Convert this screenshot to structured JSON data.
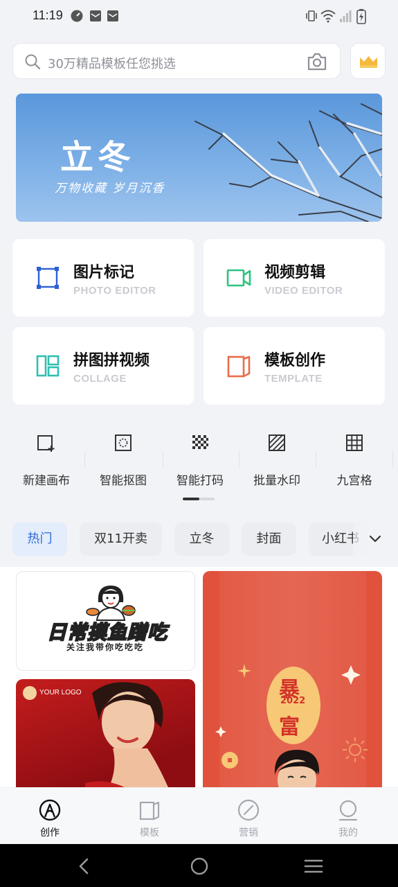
{
  "status_bar": {
    "time": "11:19",
    "icons_left": [
      "speed-icon",
      "mail-icon",
      "mail-icon"
    ],
    "icons_right": [
      "vibrate-icon",
      "wifi-icon",
      "signal-icon",
      "battery-charging-icon"
    ]
  },
  "search": {
    "placeholder": "30万精品模板任您挑选",
    "icon": "search-icon",
    "camera_icon": "camera-icon",
    "vip_icon": "crown-icon"
  },
  "banner": {
    "title": "立冬",
    "subtitle": "万物收藏 岁月沉香"
  },
  "tools": [
    {
      "title": "图片标记",
      "subtitle": "PHOTO EDITOR",
      "icon": "crop-frame-icon",
      "color": "#2d5fd6"
    },
    {
      "title": "视频剪辑",
      "subtitle": "VIDEO EDITOR",
      "icon": "video-camera-icon",
      "color": "#2fc27f"
    },
    {
      "title": "拼图拼视频",
      "subtitle": "COLLAGE",
      "icon": "collage-icon",
      "color": "#2fbfb0"
    },
    {
      "title": "模板创作",
      "subtitle": "TEMPLATE",
      "icon": "template-icon",
      "color": "#ec6b47"
    }
  ],
  "quick_actions": [
    {
      "label": "新建画布",
      "icon": "new-canvas-icon"
    },
    {
      "label": "智能抠图",
      "icon": "smart-cutout-icon"
    },
    {
      "label": "智能打码",
      "icon": "mosaic-icon"
    },
    {
      "label": "批量水印",
      "icon": "watermark-icon"
    },
    {
      "label": "九宫格",
      "icon": "grid-icon"
    }
  ],
  "categories": [
    {
      "label": "热门",
      "active": true
    },
    {
      "label": "双11开卖",
      "active": false
    },
    {
      "label": "立冬",
      "active": false
    },
    {
      "label": "封面",
      "active": false
    },
    {
      "label": "小红书",
      "active": false
    }
  ],
  "feed": {
    "card1": {
      "title": "日常摸鱼蹭吃",
      "subtitle": "关注我带你吃吃吃"
    },
    "card2": {
      "logo_text": "YOUR LOGO"
    },
    "card3": {
      "char_top": "暴",
      "year": "2022",
      "char_bottom": "富"
    }
  },
  "tabbar": [
    {
      "label": "创作",
      "icon": "create-icon",
      "active": true
    },
    {
      "label": "模板",
      "icon": "template-tab-icon",
      "active": false
    },
    {
      "label": "营销",
      "icon": "marketing-icon",
      "active": false
    },
    {
      "label": "我的",
      "icon": "profile-icon",
      "active": false
    }
  ],
  "colors": {
    "accent": "#2d6bd6",
    "banner_sky": "#6aa3e0",
    "poster_red": "#e1523c"
  }
}
